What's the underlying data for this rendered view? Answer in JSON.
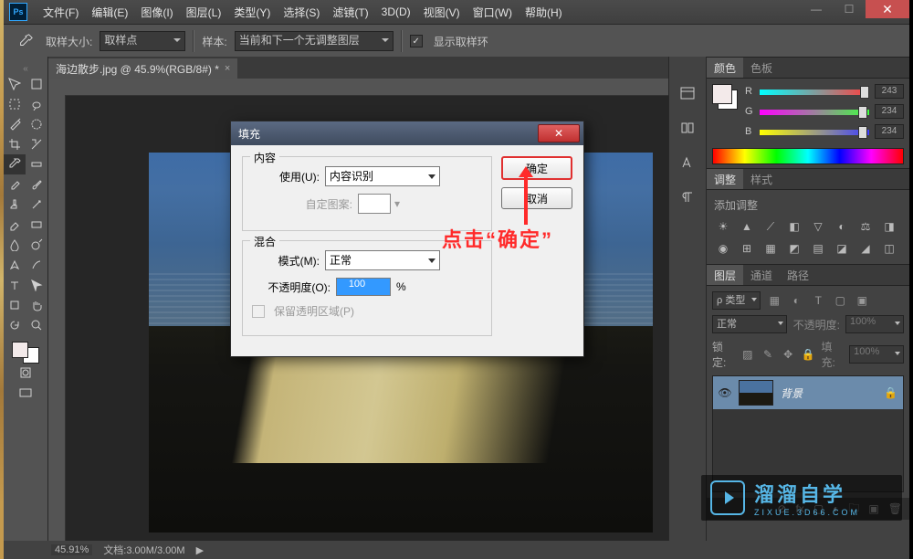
{
  "app": {
    "logo": "Ps"
  },
  "menu": [
    "文件(F)",
    "编辑(E)",
    "图像(I)",
    "图层(L)",
    "类型(Y)",
    "选择(S)",
    "滤镜(T)",
    "3D(D)",
    "视图(V)",
    "窗口(W)",
    "帮助(H)"
  ],
  "options": {
    "sample_size_label": "取样大小:",
    "sample_size_value": "取样点",
    "sample_label": "样本:",
    "sample_value": "当前和下一个无调整图层",
    "show_ring": "显示取样环"
  },
  "doc_tab": {
    "title": "海边散步.jpg @ 45.9%(RGB/8#) *"
  },
  "status": {
    "zoom": "45.91%",
    "docinfo": "文档:3.00M/3.00M"
  },
  "panels": {
    "color": {
      "tab": "颜色",
      "tab2": "色板",
      "R_label": "R",
      "G_label": "G",
      "B_label": "B",
      "R": "243",
      "G": "234",
      "B": "234"
    },
    "adjust": {
      "tab": "调整",
      "tab2": "样式",
      "hint": "添加调整"
    },
    "layers": {
      "tab1": "图层",
      "tab2": "通道",
      "tab3": "路径",
      "filter": "ρ 类型",
      "blend": "正常",
      "opacity_label": "不透明度:",
      "opacity": "100%",
      "lock_label": "锁定:",
      "fill_label": "填充:",
      "fill": "100%",
      "layer_name": "背景"
    }
  },
  "dialog": {
    "title": "填充",
    "ok": "确定",
    "cancel": "取消",
    "content_legend": "内容",
    "use_label": "使用(U):",
    "use_value": "内容识别",
    "custom_pattern": "自定图案:",
    "blend_legend": "混合",
    "mode_label": "模式(M):",
    "mode_value": "正常",
    "opacity_label": "不透明度(O):",
    "opacity_value": "100",
    "opacity_unit": "%",
    "preserve": "保留透明区域(P)"
  },
  "annotation": {
    "text": "点击“确定”"
  },
  "watermark": {
    "l1": "溜溜自学",
    "l2": "ZIXUE.3D66.COM"
  }
}
